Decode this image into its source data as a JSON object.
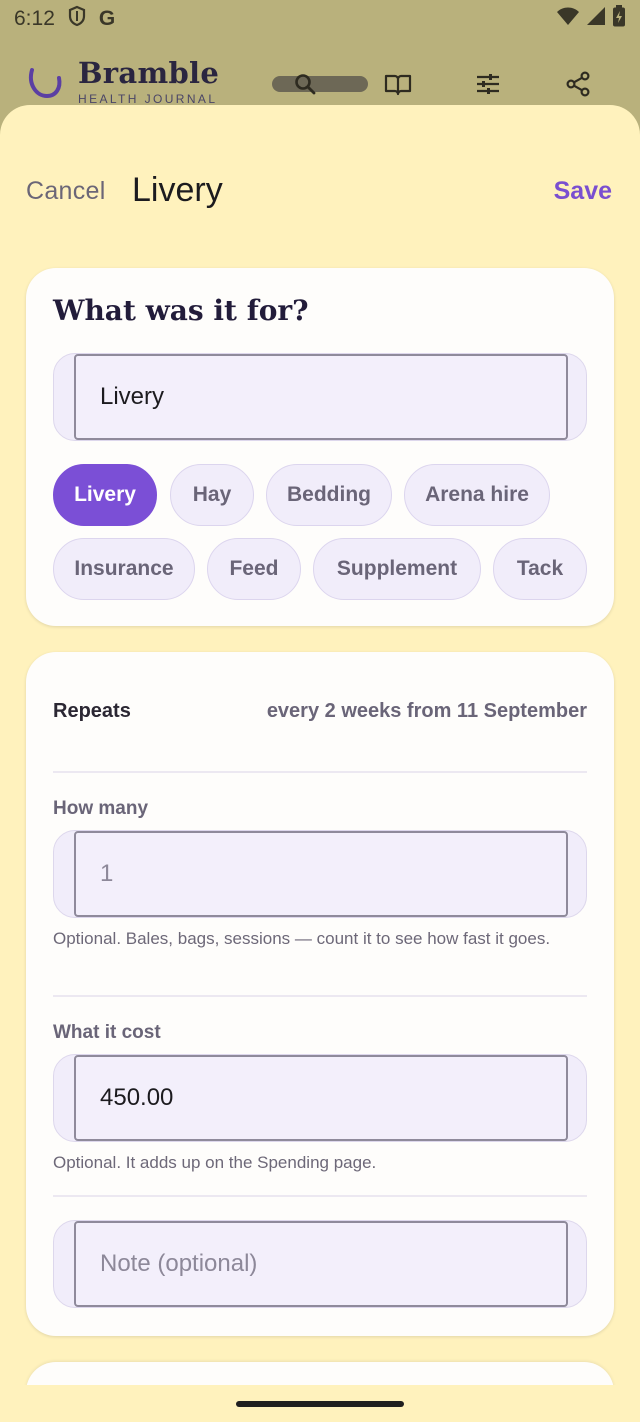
{
  "status_bar": {
    "time": "6:12",
    "g_label": "G"
  },
  "app_bar": {
    "brand_name": "Bramble",
    "brand_sub": "HEALTH JOURNAL"
  },
  "sheet": {
    "cancel_label": "Cancel",
    "title": "Livery",
    "save_label": "Save"
  },
  "purpose": {
    "heading": "What was it for?",
    "input_value": "Livery",
    "chips": [
      {
        "label": "Livery",
        "selected": true
      },
      {
        "label": "Hay",
        "selected": false
      },
      {
        "label": "Bedding",
        "selected": false
      },
      {
        "label": "Arena hire",
        "selected": false
      },
      {
        "label": "Insurance",
        "selected": false
      },
      {
        "label": "Feed",
        "selected": false
      },
      {
        "label": "Supplement",
        "selected": false
      },
      {
        "label": "Tack",
        "selected": false
      }
    ]
  },
  "details": {
    "repeats_label": "Repeats",
    "repeats_value": "every 2 weeks from 11 September",
    "quantity_label": "How many",
    "quantity_placeholder": "1",
    "quantity_helper": "Optional. Bales, bags, sessions — count it to see how fast it goes.",
    "cost_label": "What it cost",
    "cost_value": "450.00",
    "cost_helper": "Optional. It adds up on the Spending page.",
    "note_placeholder": "Note (optional)"
  },
  "colors": {
    "accent": "#7b4fd6",
    "sheet_bg": "#fff2bd",
    "card_bg": "#fefdfb"
  }
}
